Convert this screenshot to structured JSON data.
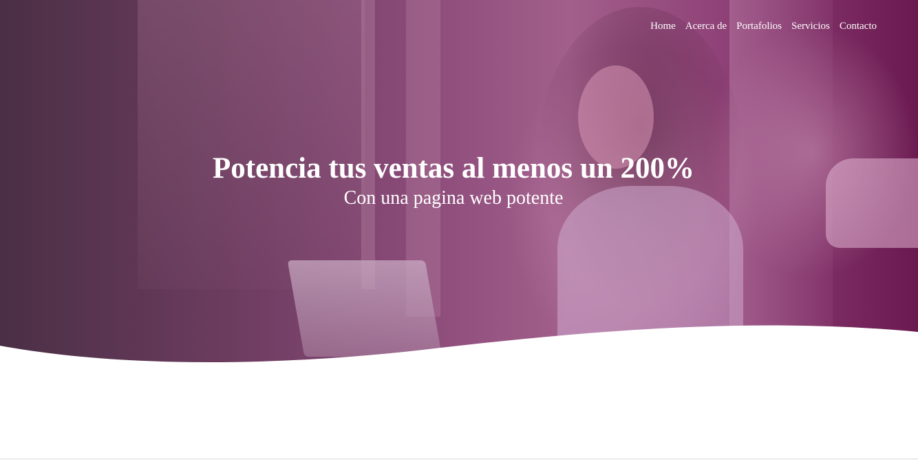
{
  "nav": {
    "items": [
      {
        "label": "Home"
      },
      {
        "label": "Acerca de"
      },
      {
        "label": "Portafolios"
      },
      {
        "label": "Servicios"
      },
      {
        "label": "Contacto"
      }
    ]
  },
  "hero": {
    "title": "Potencia tus ventas al menos un 200%",
    "subtitle": "Con una pagina web potente",
    "overlay_colors": [
      "#4a2f45",
      "#8a4a78",
      "#6b1a50"
    ]
  }
}
